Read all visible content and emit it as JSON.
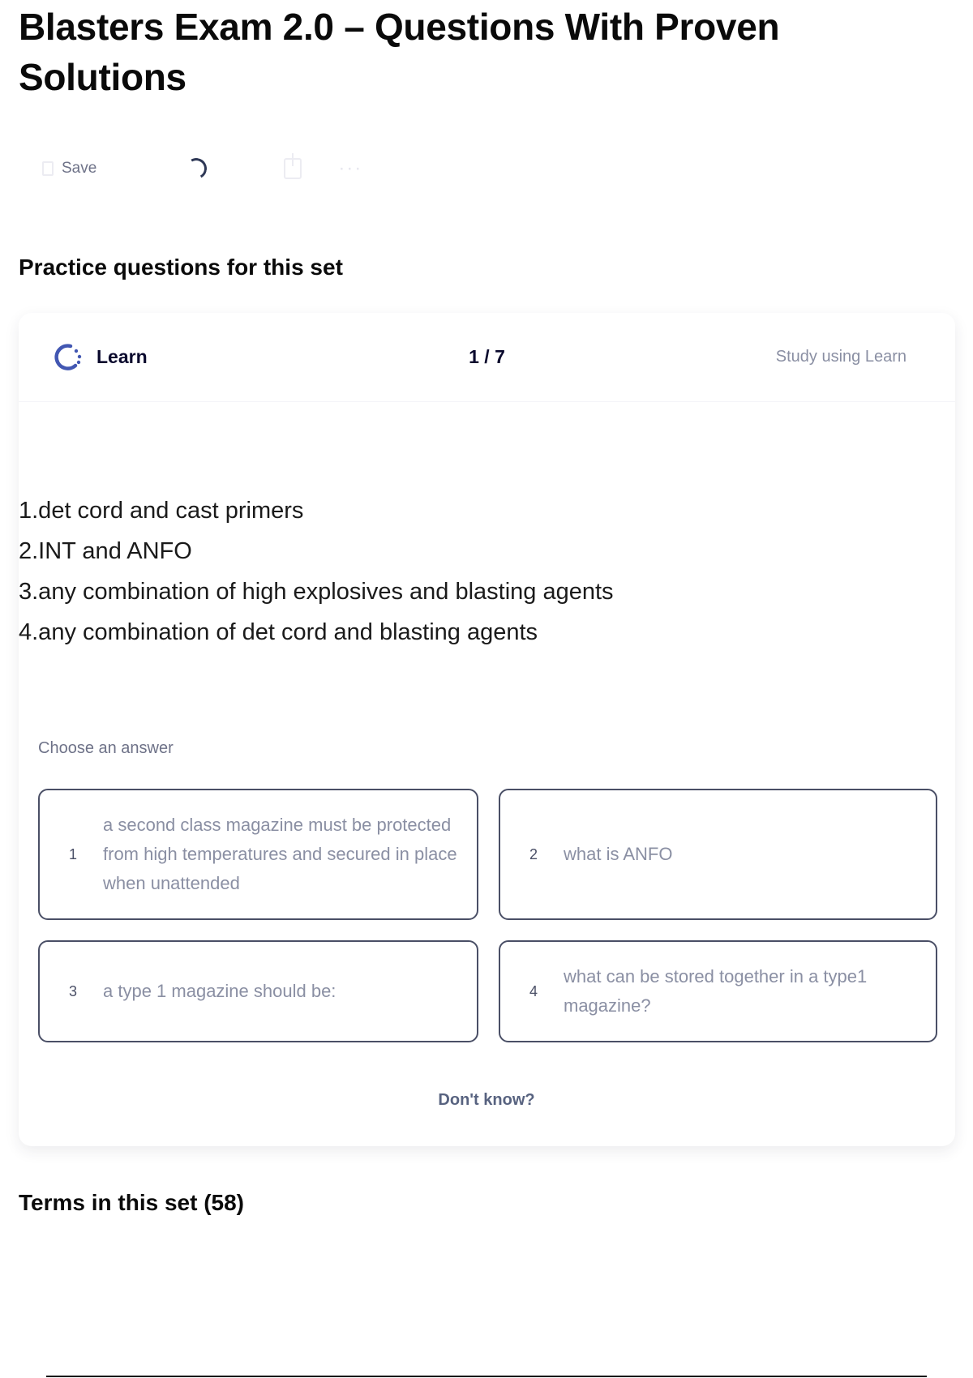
{
  "page": {
    "title": "Blasters Exam 2.0 – Questions With Proven Solutions"
  },
  "toolbar": {
    "save_label": "Save",
    "more_label": "···"
  },
  "practice": {
    "heading": "Practice questions for this set",
    "mode_label": "Learn",
    "progress": "1 / 7",
    "study_link": "Study using Learn",
    "question_lines": [
      "1.det cord and cast primers",
      "2.INT and ANFO",
      "3.any combination of high explosives and blasting agents",
      "4.any combination of det cord and blasting agents"
    ],
    "choose_label": "Choose an answer",
    "options": [
      {
        "num": "1",
        "text": "a second class magazine must be protected from high temperatures and secured in place when unattended"
      },
      {
        "num": "2",
        "text": "what is ANFO"
      },
      {
        "num": "3",
        "text": "a type 1 magazine should be:"
      },
      {
        "num": "4",
        "text": "what can be stored together in a type1 magazine?"
      }
    ],
    "dont_know": "Don't know?"
  },
  "terms": {
    "heading": "Terms in this set (58)"
  },
  "colors": {
    "learn_icon": "#4257b2",
    "option_border": "#4a4f66",
    "muted_text": "#8a8fa3"
  }
}
